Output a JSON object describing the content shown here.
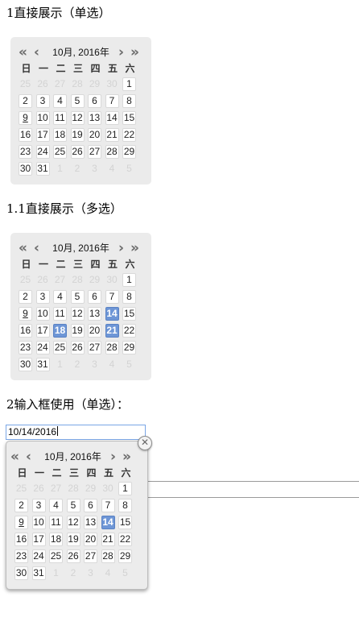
{
  "sections": {
    "s1_title": "1直接展示（单选）",
    "s2_title": "1.1直接展示（多选）",
    "s3_title": "2输入框使用（单选）："
  },
  "calendar": {
    "month_label": "10月, 2016年",
    "nav": {
      "prev_year": "«",
      "prev_month": "‹",
      "next_month": "›",
      "next_year": "»"
    },
    "weekdays": [
      "日",
      "一",
      "二",
      "三",
      "四",
      "五",
      "六"
    ],
    "leading_days": [
      "25",
      "26",
      "27",
      "28",
      "29",
      "30"
    ],
    "month_days": [
      "1",
      "2",
      "3",
      "4",
      "5",
      "6",
      "7",
      "8",
      "9",
      "10",
      "11",
      "12",
      "13",
      "14",
      "15",
      "16",
      "17",
      "18",
      "19",
      "20",
      "21",
      "22",
      "23",
      "24",
      "25",
      "26",
      "27",
      "28",
      "29",
      "30",
      "31"
    ],
    "trailing_days": [
      "1",
      "2",
      "3",
      "4",
      "5"
    ]
  },
  "calendars": [
    {
      "id": "single",
      "today": 9,
      "selected": []
    },
    {
      "id": "multi",
      "today": 9,
      "selected": [
        14,
        18,
        21
      ]
    },
    {
      "id": "input",
      "today": 9,
      "selected": [
        14
      ]
    }
  ],
  "input": {
    "value": "10/14/2016"
  },
  "close_glyph": "✕",
  "colors": {
    "selected": "#6e96d6",
    "calendar_bg": "#ebebeb",
    "input_border": "#7aa6e6"
  }
}
